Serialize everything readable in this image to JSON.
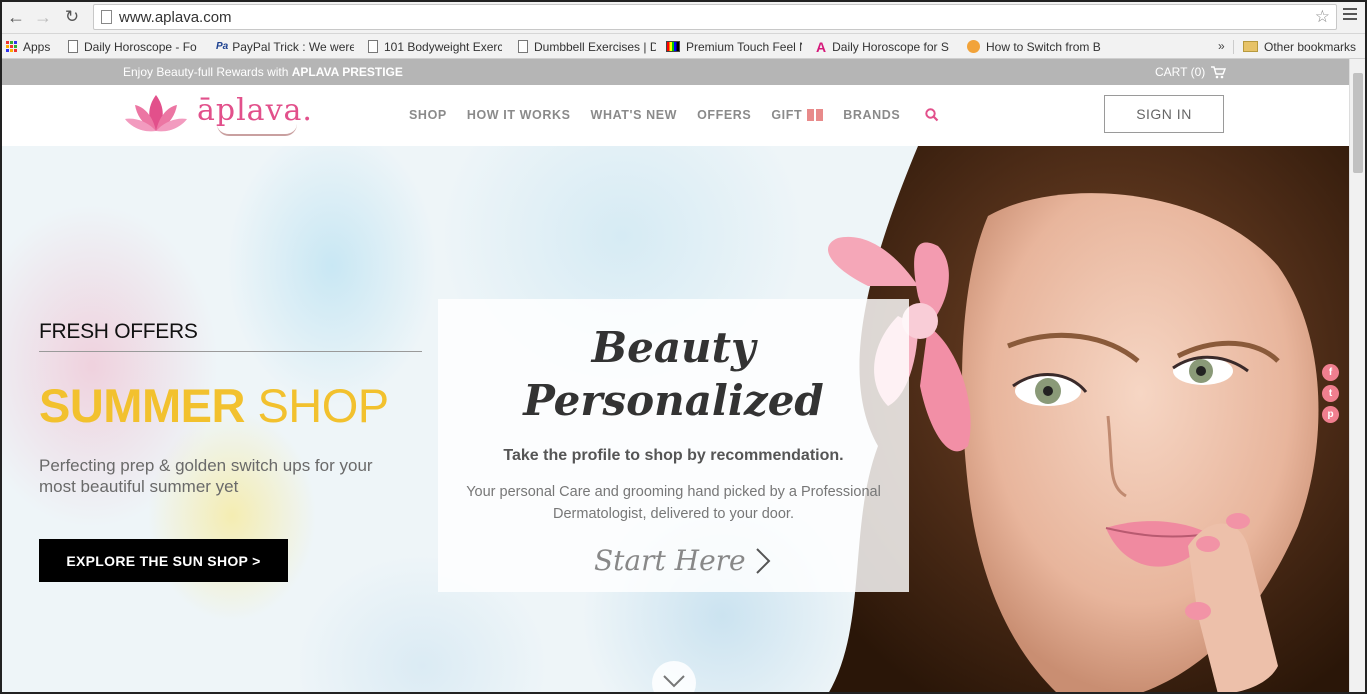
{
  "browser": {
    "url": "www.aplava.com",
    "bookmarks": [
      {
        "label": "Apps",
        "icon": "apps-grid-icon"
      },
      {
        "label": "Daily Horoscope - Fo",
        "icon": "page-icon"
      },
      {
        "label": "PayPal Trick : We were",
        "icon": "paypal-icon"
      },
      {
        "label": "101 Bodyweight Exerc",
        "icon": "page-icon"
      },
      {
        "label": "Dumbbell Exercises | D",
        "icon": "page-icon"
      },
      {
        "label": "Premium Touch Feel N",
        "icon": "tv-icon"
      },
      {
        "label": "Daily Horoscope for S",
        "icon": "a-logo-icon"
      },
      {
        "label": "How to Switch from B",
        "icon": "swirl-icon"
      }
    ],
    "more_glyph": "»",
    "other_bookmarks": "Other bookmarks"
  },
  "promo": {
    "text": "Enjoy Beauty-full Rewards with ",
    "highlight": "APLAVA PRESTIGE",
    "cart_label": "CART (0)"
  },
  "header": {
    "logo_text": "āplava.",
    "nav": [
      "SHOP",
      "HOW IT WORKS",
      "WHAT'S NEW",
      "OFFERS",
      "GIFT",
      "BRANDS"
    ],
    "signin_label": "SIGN IN"
  },
  "hero": {
    "eyebrow": "FRESH OFFERS",
    "headline_bold": "SUMMER",
    "headline_rest": " SHOP",
    "subtitle": "Perfecting prep & golden switch ups for your most beautiful summer yet",
    "cta_label": "EXPLORE THE SUN SHOP >",
    "card": {
      "title_line1": "Beauty",
      "title_line2": "Personalized",
      "subtitle": "Take the profile to shop by recommendation.",
      "description": "Your personal Care and grooming hand picked by a Professional Dermatologist, delivered to your door.",
      "cta": "Start Here"
    },
    "social": [
      {
        "name": "facebook-icon",
        "glyph": "f"
      },
      {
        "name": "twitter-icon",
        "glyph": "t"
      },
      {
        "name": "pinterest-icon",
        "glyph": "p"
      }
    ]
  },
  "colors": {
    "brand_pink": "#e2508b",
    "summer_yellow": "#f2c12e",
    "promo_gray": "#b5b5b5",
    "cta_black": "#000000"
  }
}
